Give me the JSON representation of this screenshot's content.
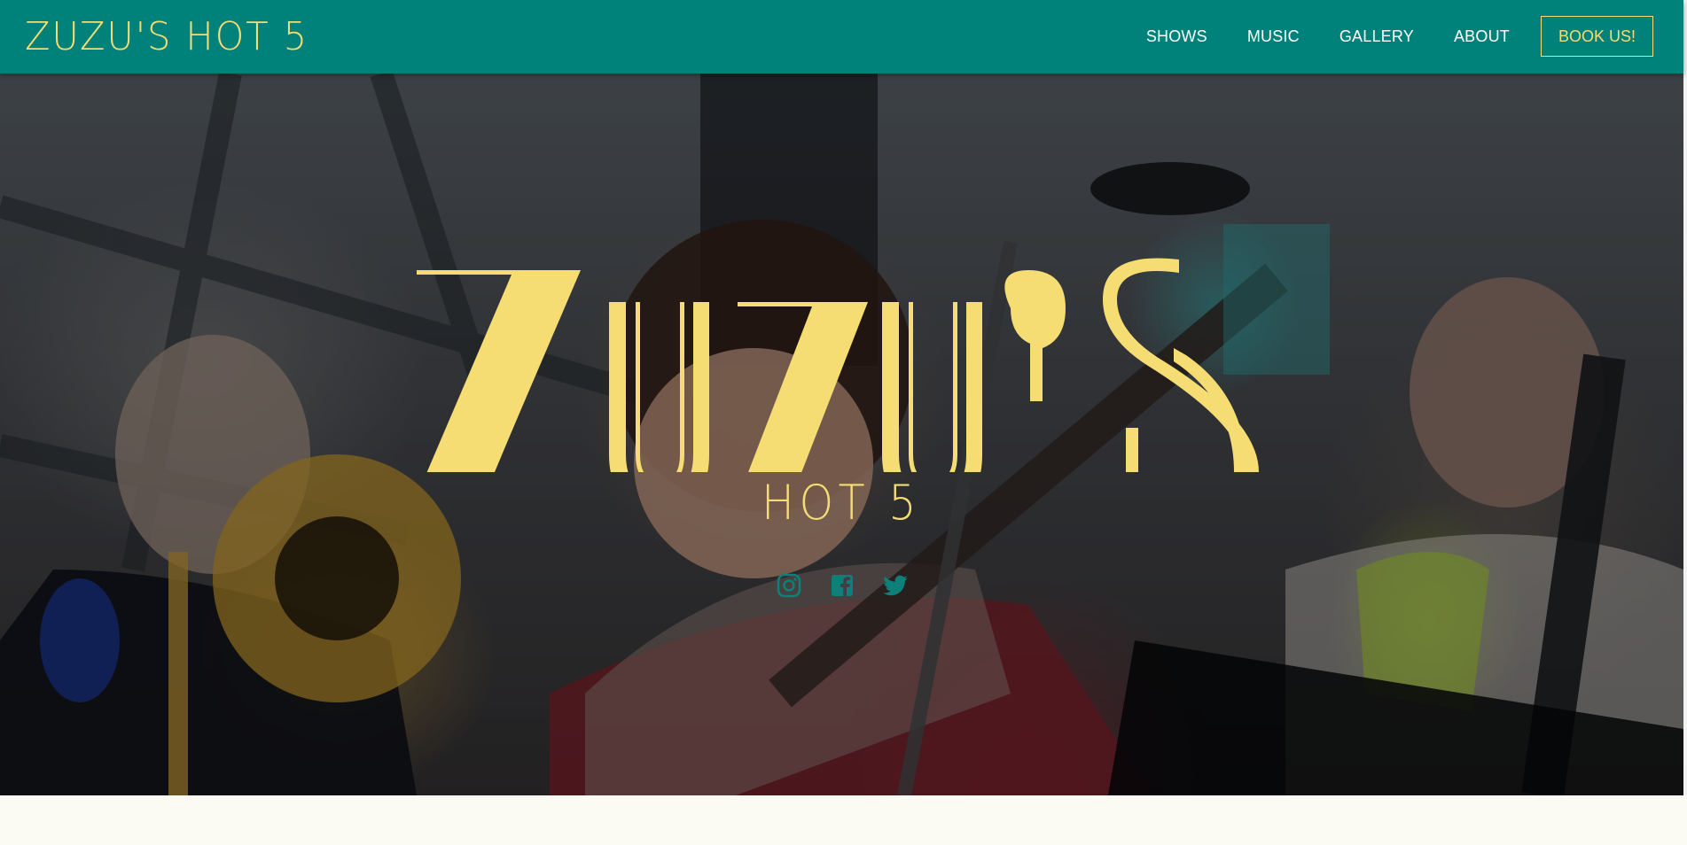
{
  "header": {
    "brand_logo_text": "ZUZU'S HOT 5",
    "nav": [
      "SHOWS",
      "MUSIC",
      "GALLERY",
      "ABOUT"
    ],
    "book_label": "BOOK US!"
  },
  "hero": {
    "logo_text": "ZUZU'S",
    "subtitle": "HOT 5",
    "social_icons": [
      "instagram-icon",
      "facebook-icon",
      "twitter-icon"
    ]
  },
  "colors": {
    "header_bg": "#00827b",
    "accent_yellow": "#f5dd74",
    "social_teal": "#0f7f79",
    "page_bg": "#fcfbf3"
  }
}
